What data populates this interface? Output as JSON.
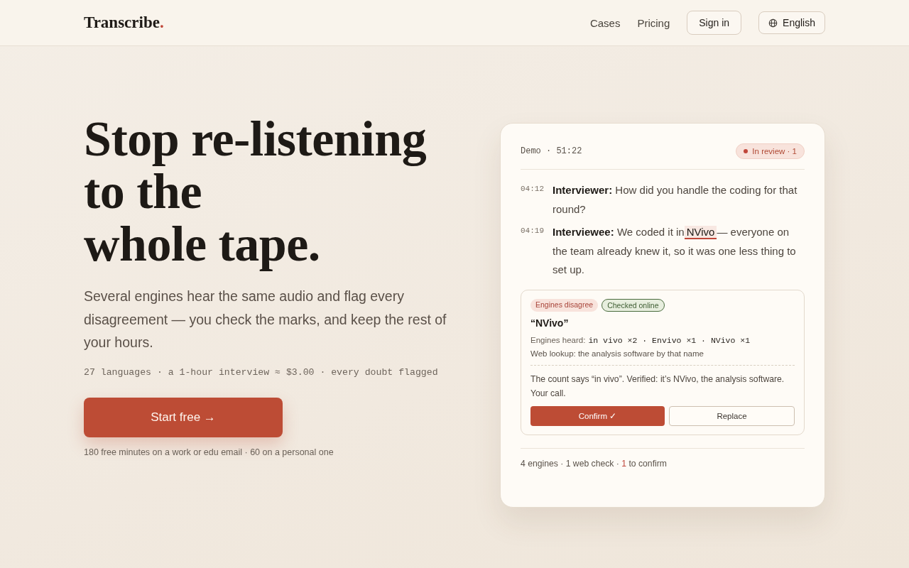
{
  "header": {
    "logo": {
      "name": "Transcribe",
      "mark": "."
    },
    "nav": [
      {
        "label": "Cases",
        "kind": "link"
      },
      {
        "label": "Pricing",
        "kind": "link"
      },
      {
        "label": "Sign in",
        "kind": "button"
      },
      {
        "label": "English",
        "kind": "language"
      }
    ]
  },
  "hero": {
    "title_lines": [
      "Stop re-listening",
      "to the",
      "whole tape."
    ],
    "lead": "Several engines hear the same audio and flag every disagreement — you check the marks, and keep the rest of your hours.",
    "facts": "27 languages · a 1-hour interview ≈ $3.00 · every doubt flagged",
    "cta": "Start free →",
    "note": "180 free minutes on a work or edu email · 60 on a personal one"
  },
  "demo": {
    "label": "Demo · 51:22",
    "status": "In review · 1",
    "lines": [
      {
        "time": "04:12",
        "speaker": "Interviewer:",
        "before": "How did you handle the coding for that round?"
      },
      {
        "time": "04:19",
        "speaker": "Interviewee:",
        "before": "We coded it in",
        "flagged": "NVivo",
        "after": "— everyone on the team already knew it, so it was one less thing to set up."
      }
    ],
    "flag": {
      "tags": [
        {
          "label": "Engines disagree",
          "kind": "warning"
        },
        {
          "label": "Checked online",
          "kind": "verified"
        }
      ],
      "term": "“NVivo”",
      "heard_label": "Engines heard:",
      "heard": "in vivo ×2 · Envivo ×1 · NVivo ×1",
      "lookup": "Web lookup: the analysis software by that name",
      "verdict": "The count says “in vivo”. Verified: it’s NVivo, the analysis software. Your call.",
      "buttons": [
        {
          "label": "Confirm ✓",
          "kind": "primary"
        },
        {
          "label": "Replace",
          "kind": "secondary"
        }
      ]
    },
    "footer": [
      {
        "text": "4 engines · 1 web check · ",
        "kind": "plain"
      },
      {
        "text": "1",
        "kind": "accent"
      },
      {
        "text": " to confirm",
        "kind": "plain"
      }
    ]
  }
}
